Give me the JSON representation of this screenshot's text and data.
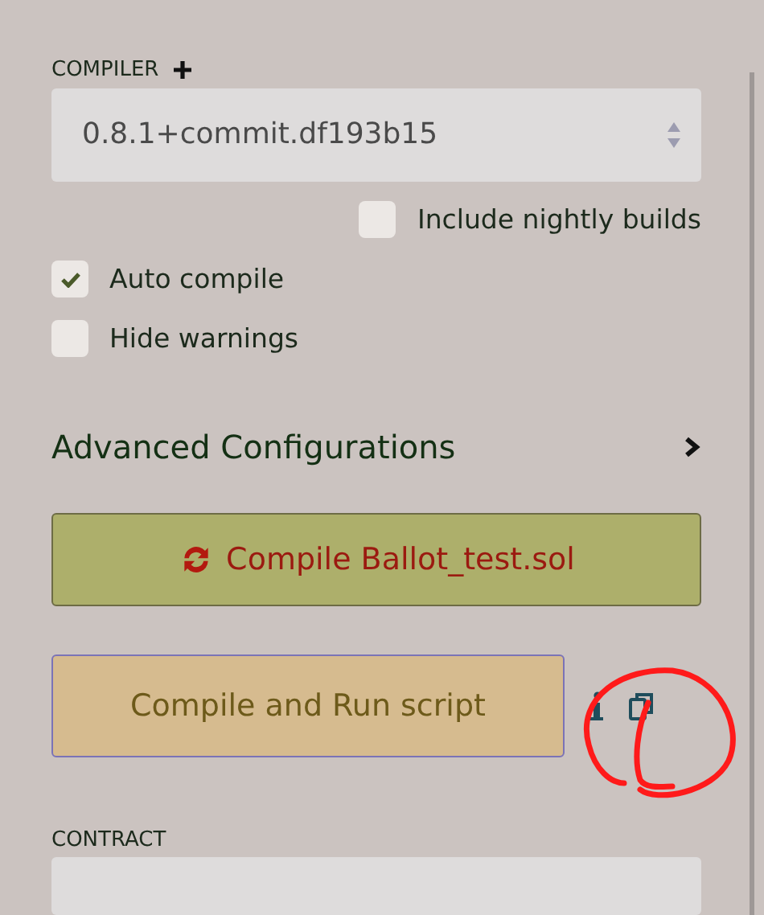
{
  "compiler": {
    "label": "COMPILER",
    "version": "0.8.1+commit.df193b15"
  },
  "nightly": {
    "label": "Include nightly builds",
    "checked": false
  },
  "options": [
    {
      "label": "Auto compile",
      "checked": true
    },
    {
      "label": "Hide warnings",
      "checked": false
    }
  ],
  "advanced": {
    "label": "Advanced Configurations",
    "expanded": false
  },
  "compile_button": {
    "label": "Compile Ballot_test.sol"
  },
  "run_button": {
    "label": "Compile and Run script"
  },
  "contract": {
    "label": "CONTRACT"
  }
}
